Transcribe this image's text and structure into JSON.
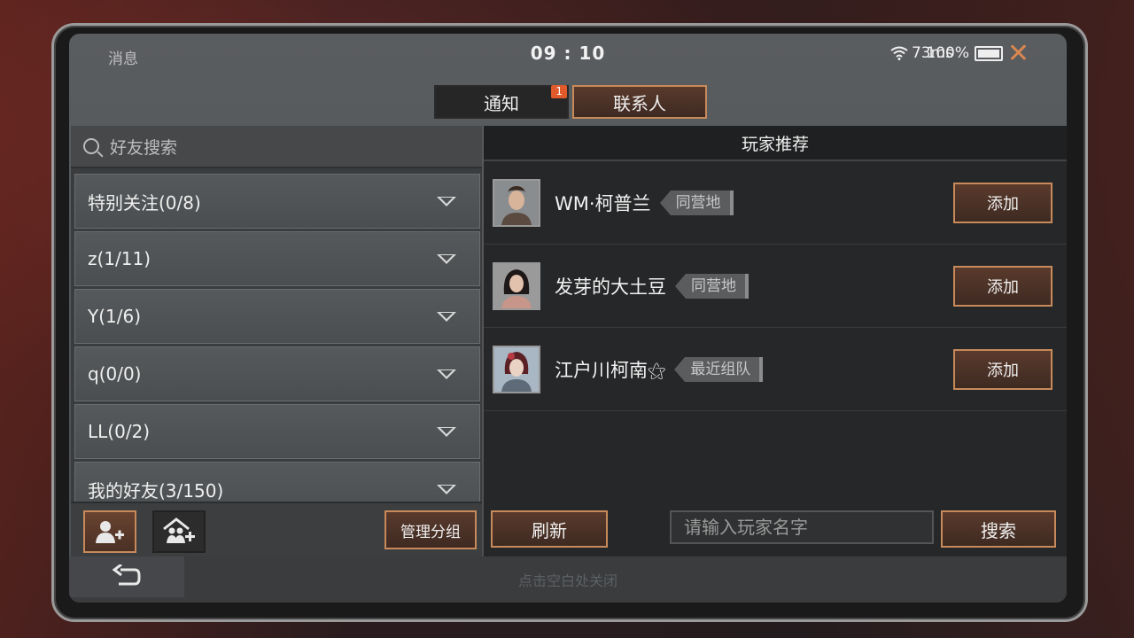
{
  "status": {
    "message_label": "消息",
    "time": "09 : 10",
    "ping": "73ms",
    "battery": "100%",
    "battery_level": 1.0
  },
  "tabs": [
    {
      "label": "通知",
      "badge": "1"
    },
    {
      "label": "联系人"
    }
  ],
  "left": {
    "search_placeholder": "好友搜索",
    "groups": [
      {
        "label": "特别关注(0/8)"
      },
      {
        "label": "z(1/11)"
      },
      {
        "label": "Y(1/6)"
      },
      {
        "label": "q(0/0)"
      },
      {
        "label": "LL(0/2)"
      },
      {
        "label": "我的好友(3/150)"
      }
    ],
    "manage_label": "管理分组"
  },
  "right": {
    "header": "玩家推荐",
    "players": [
      {
        "name": "WM·柯普兰",
        "tag": "同营地",
        "add_label": "添加"
      },
      {
        "name": "发芽的大土豆",
        "tag": "同营地",
        "add_label": "添加"
      },
      {
        "name": "江户川柯南⚝",
        "tag": "最近组队",
        "add_label": "添加"
      }
    ],
    "refresh_label": "刷新",
    "input_placeholder": "请输入玩家名字",
    "search_label": "搜索"
  },
  "footer": {
    "hint": "点击空白处关闭"
  },
  "colors": {
    "accent": "#c88a5a",
    "badge": "#e15a2c",
    "close": "#d9874f"
  }
}
